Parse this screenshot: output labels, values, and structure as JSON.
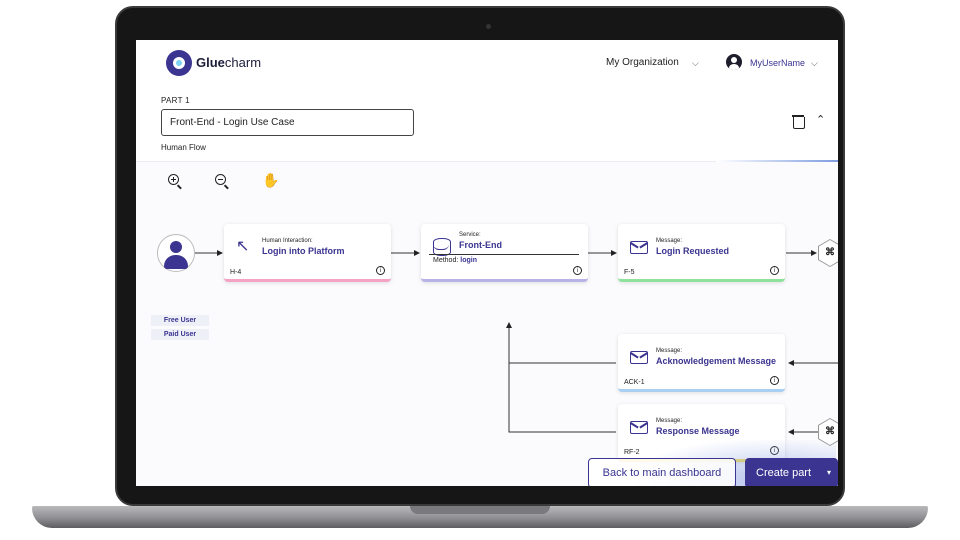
{
  "header": {
    "logo_text_bold": "Glue",
    "logo_text_rest": "charm",
    "organization": "My Organization",
    "username": "MyUserName"
  },
  "part": {
    "label": "PART 1",
    "name_value": "Front-End - Login Use Case",
    "flow_type": "Human Flow"
  },
  "toolbar": {
    "zoom_in": "zoom-in-icon",
    "zoom_out": "zoom-out-icon",
    "pan": "hand-icon"
  },
  "actor": {
    "roles": [
      "Free User",
      "Paid User"
    ]
  },
  "nodes": [
    {
      "kind": "Human Interaction:",
      "title": "Login into Platform",
      "code": "H-4",
      "accent": "#f5a3c4",
      "icon": "cursor-click-icon"
    },
    {
      "kind": "Service:",
      "title": "Front-End",
      "method_label": "Method:",
      "method_value": "login",
      "accent": "#b8b3e6",
      "icon": "database-icon"
    },
    {
      "kind": "Message:",
      "title": "Login Requested",
      "code": "F-5",
      "accent": "#8fe29b",
      "icon": "envelope-icon"
    },
    {
      "kind": "Message:",
      "title": "Acknowledgement Message",
      "code": "ACK-1",
      "accent": "#a9d0f2",
      "icon": "envelope-icon"
    },
    {
      "kind": "Message:",
      "title": "Response Message",
      "code": "RF-2",
      "accent": "#f4df61",
      "icon": "envelope-icon"
    }
  ],
  "actions": {
    "back": "Back to main dashboard",
    "create": "Create part"
  },
  "colors": {
    "brand": "#3b3490"
  }
}
